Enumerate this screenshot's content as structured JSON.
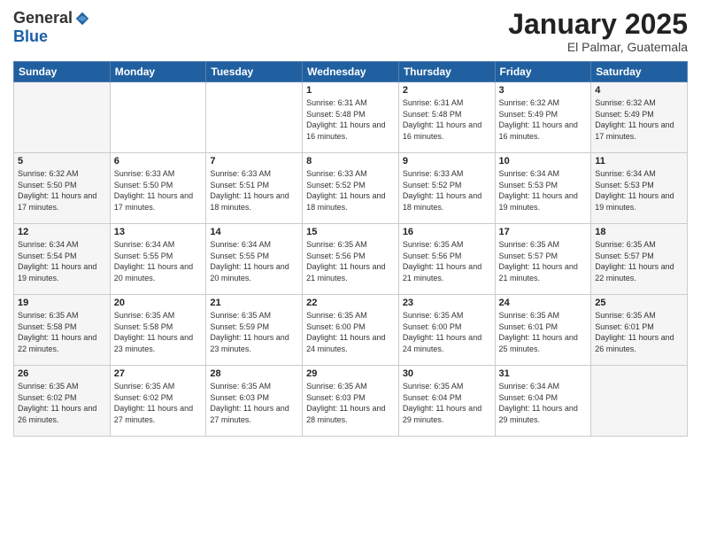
{
  "logo": {
    "general": "General",
    "blue": "Blue"
  },
  "title": "January 2025",
  "location": "El Palmar, Guatemala",
  "days_of_week": [
    "Sunday",
    "Monday",
    "Tuesday",
    "Wednesday",
    "Thursday",
    "Friday",
    "Saturday"
  ],
  "weeks": [
    [
      {
        "day": "",
        "info": ""
      },
      {
        "day": "",
        "info": ""
      },
      {
        "day": "",
        "info": ""
      },
      {
        "day": "1",
        "info": "Sunrise: 6:31 AM\nSunset: 5:48 PM\nDaylight: 11 hours\nand 16 minutes."
      },
      {
        "day": "2",
        "info": "Sunrise: 6:31 AM\nSunset: 5:48 PM\nDaylight: 11 hours\nand 16 minutes."
      },
      {
        "day": "3",
        "info": "Sunrise: 6:32 AM\nSunset: 5:49 PM\nDaylight: 11 hours\nand 16 minutes."
      },
      {
        "day": "4",
        "info": "Sunrise: 6:32 AM\nSunset: 5:49 PM\nDaylight: 11 hours\nand 17 minutes."
      }
    ],
    [
      {
        "day": "5",
        "info": "Sunrise: 6:32 AM\nSunset: 5:50 PM\nDaylight: 11 hours\nand 17 minutes."
      },
      {
        "day": "6",
        "info": "Sunrise: 6:33 AM\nSunset: 5:50 PM\nDaylight: 11 hours\nand 17 minutes."
      },
      {
        "day": "7",
        "info": "Sunrise: 6:33 AM\nSunset: 5:51 PM\nDaylight: 11 hours\nand 18 minutes."
      },
      {
        "day": "8",
        "info": "Sunrise: 6:33 AM\nSunset: 5:52 PM\nDaylight: 11 hours\nand 18 minutes."
      },
      {
        "day": "9",
        "info": "Sunrise: 6:33 AM\nSunset: 5:52 PM\nDaylight: 11 hours\nand 18 minutes."
      },
      {
        "day": "10",
        "info": "Sunrise: 6:34 AM\nSunset: 5:53 PM\nDaylight: 11 hours\nand 19 minutes."
      },
      {
        "day": "11",
        "info": "Sunrise: 6:34 AM\nSunset: 5:53 PM\nDaylight: 11 hours\nand 19 minutes."
      }
    ],
    [
      {
        "day": "12",
        "info": "Sunrise: 6:34 AM\nSunset: 5:54 PM\nDaylight: 11 hours\nand 19 minutes."
      },
      {
        "day": "13",
        "info": "Sunrise: 6:34 AM\nSunset: 5:55 PM\nDaylight: 11 hours\nand 20 minutes."
      },
      {
        "day": "14",
        "info": "Sunrise: 6:34 AM\nSunset: 5:55 PM\nDaylight: 11 hours\nand 20 minutes."
      },
      {
        "day": "15",
        "info": "Sunrise: 6:35 AM\nSunset: 5:56 PM\nDaylight: 11 hours\nand 21 minutes."
      },
      {
        "day": "16",
        "info": "Sunrise: 6:35 AM\nSunset: 5:56 PM\nDaylight: 11 hours\nand 21 minutes."
      },
      {
        "day": "17",
        "info": "Sunrise: 6:35 AM\nSunset: 5:57 PM\nDaylight: 11 hours\nand 21 minutes."
      },
      {
        "day": "18",
        "info": "Sunrise: 6:35 AM\nSunset: 5:57 PM\nDaylight: 11 hours\nand 22 minutes."
      }
    ],
    [
      {
        "day": "19",
        "info": "Sunrise: 6:35 AM\nSunset: 5:58 PM\nDaylight: 11 hours\nand 22 minutes."
      },
      {
        "day": "20",
        "info": "Sunrise: 6:35 AM\nSunset: 5:58 PM\nDaylight: 11 hours\nand 23 minutes."
      },
      {
        "day": "21",
        "info": "Sunrise: 6:35 AM\nSunset: 5:59 PM\nDaylight: 11 hours\nand 23 minutes."
      },
      {
        "day": "22",
        "info": "Sunrise: 6:35 AM\nSunset: 6:00 PM\nDaylight: 11 hours\nand 24 minutes."
      },
      {
        "day": "23",
        "info": "Sunrise: 6:35 AM\nSunset: 6:00 PM\nDaylight: 11 hours\nand 24 minutes."
      },
      {
        "day": "24",
        "info": "Sunrise: 6:35 AM\nSunset: 6:01 PM\nDaylight: 11 hours\nand 25 minutes."
      },
      {
        "day": "25",
        "info": "Sunrise: 6:35 AM\nSunset: 6:01 PM\nDaylight: 11 hours\nand 26 minutes."
      }
    ],
    [
      {
        "day": "26",
        "info": "Sunrise: 6:35 AM\nSunset: 6:02 PM\nDaylight: 11 hours\nand 26 minutes."
      },
      {
        "day": "27",
        "info": "Sunrise: 6:35 AM\nSunset: 6:02 PM\nDaylight: 11 hours\nand 27 minutes."
      },
      {
        "day": "28",
        "info": "Sunrise: 6:35 AM\nSunset: 6:03 PM\nDaylight: 11 hours\nand 27 minutes."
      },
      {
        "day": "29",
        "info": "Sunrise: 6:35 AM\nSunset: 6:03 PM\nDaylight: 11 hours\nand 28 minutes."
      },
      {
        "day": "30",
        "info": "Sunrise: 6:35 AM\nSunset: 6:04 PM\nDaylight: 11 hours\nand 29 minutes."
      },
      {
        "day": "31",
        "info": "Sunrise: 6:34 AM\nSunset: 6:04 PM\nDaylight: 11 hours\nand 29 minutes."
      },
      {
        "day": "",
        "info": ""
      }
    ]
  ]
}
